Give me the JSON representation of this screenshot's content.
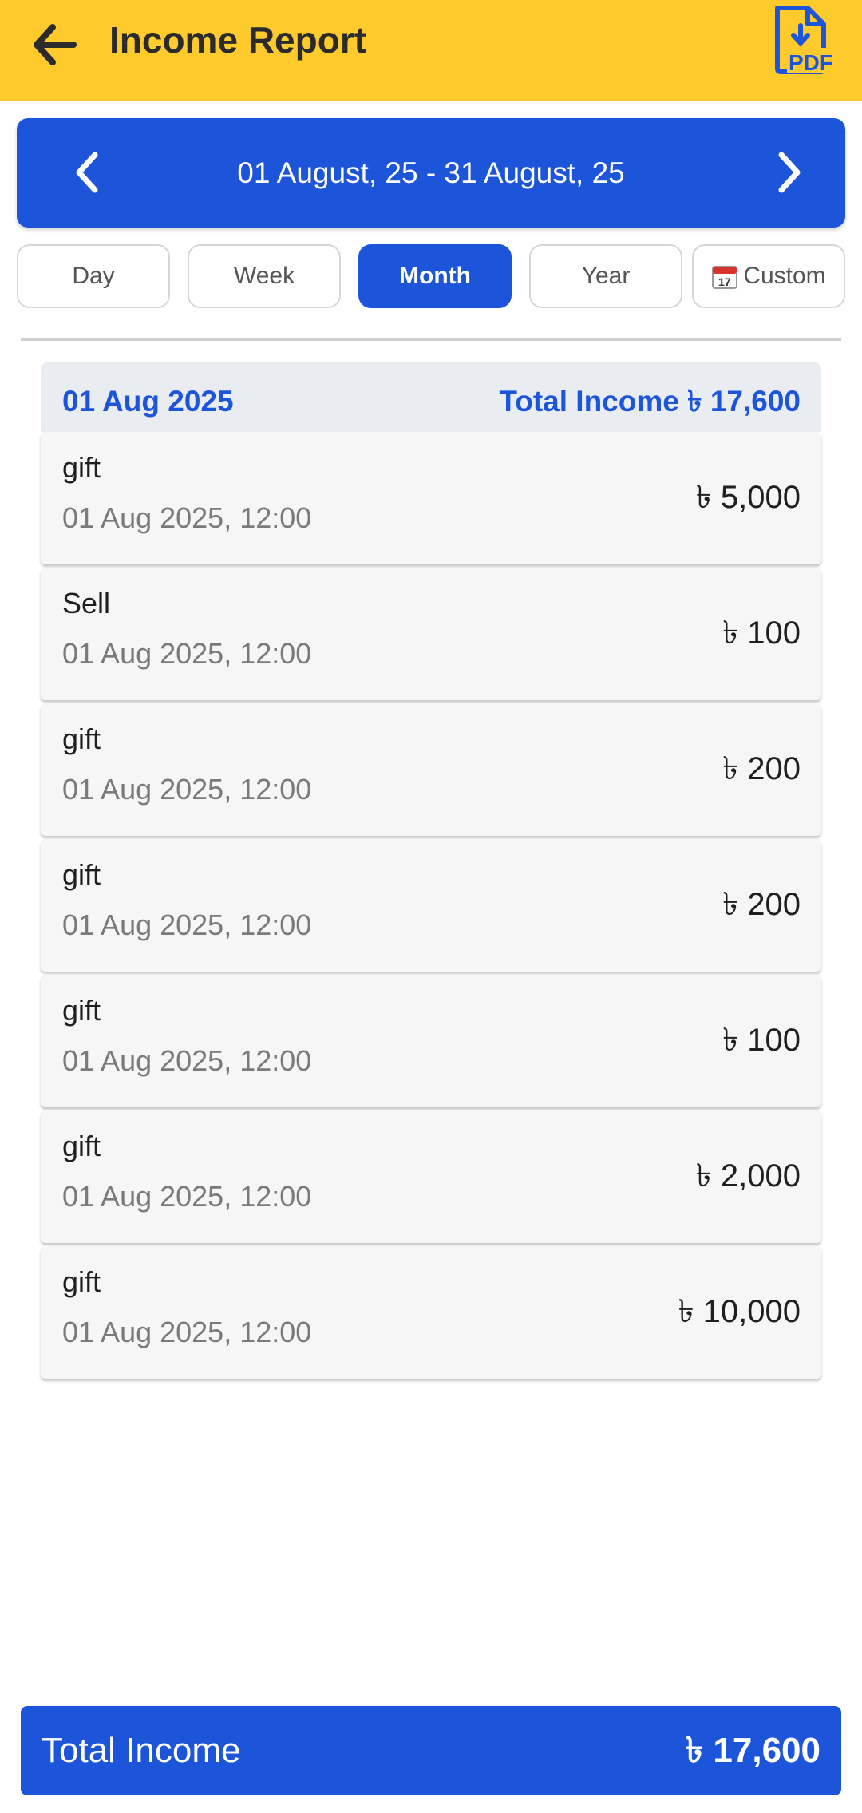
{
  "appbar": {
    "title": "Income Report",
    "back_icon": "arrow-left-icon",
    "pdf_icon": "pdf-download-icon",
    "pdf_label": "PDF",
    "background": "#ffca2c"
  },
  "date_range": {
    "text": "01 August, 25 - 31 August, 25",
    "prev_icon": "chevron-left-icon",
    "next_icon": "chevron-right-icon"
  },
  "tabs": [
    {
      "label": "Day",
      "active": false
    },
    {
      "label": "Week",
      "active": false
    },
    {
      "label": "Month",
      "active": true
    },
    {
      "label": "Year",
      "active": false
    },
    {
      "label": "Custom",
      "active": false,
      "icon": "calendar-icon"
    }
  ],
  "group": {
    "date": "01 Aug 2025",
    "total": "Total Income ৳ 17,600",
    "items": [
      {
        "category": "gift",
        "time": "01 Aug 2025, 12:00",
        "amount": "৳ 5,000"
      },
      {
        "category": "Sell",
        "time": "01 Aug 2025, 12:00",
        "amount": "৳ 100"
      },
      {
        "category": "gift",
        "time": "01 Aug 2025, 12:00",
        "amount": "৳ 200"
      },
      {
        "category": "gift",
        "time": "01 Aug 2025, 12:00",
        "amount": "৳ 200"
      },
      {
        "category": "gift",
        "time": "01 Aug 2025, 12:00",
        "amount": "৳ 100"
      },
      {
        "category": "gift",
        "time": "01 Aug 2025, 12:00",
        "amount": "৳ 2,000"
      },
      {
        "category": "gift",
        "time": "01 Aug 2025, 12:00",
        "amount": "৳ 10,000"
      }
    ]
  },
  "footer": {
    "label": "Total Income",
    "value": "৳ 17,600"
  },
  "colors": {
    "primary": "#1c55d9",
    "accent": "#ffca2c"
  }
}
